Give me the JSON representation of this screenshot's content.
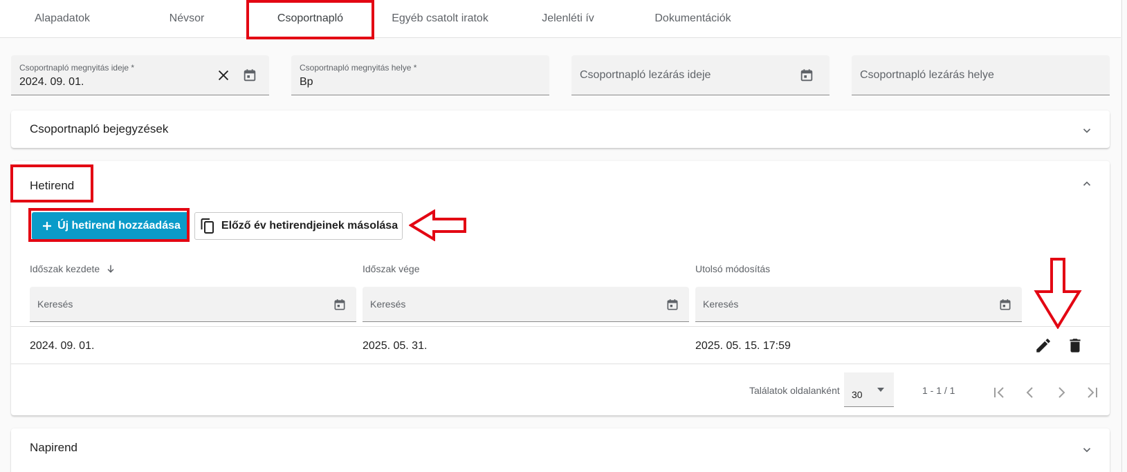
{
  "tabs": [
    {
      "label": "Alapadatok"
    },
    {
      "label": "Névsor"
    },
    {
      "label": "Csoportnapló"
    },
    {
      "label": "Egyéb csatolt iratok"
    },
    {
      "label": "Jelenléti ív"
    },
    {
      "label": "Dokumentációk"
    }
  ],
  "active_tab": "Csoportnapló",
  "form": {
    "open_date_label": "Csoportnapló megnyitás ideje *",
    "open_date_value": "2024. 09. 01.",
    "open_place_label": "Csoportnapló megnyitás helye *",
    "open_place_value": "Bp",
    "close_date_placeholder": "Csoportnapló lezárás ideje",
    "close_place_placeholder": "Csoportnapló lezárás helye"
  },
  "panels": {
    "entries_title": "Csoportnapló bejegyzések",
    "weekly_title": "Hetirend",
    "daily_title": "Napirend"
  },
  "weekly": {
    "add_button": "Új hetirend hozzáadása",
    "copy_button": "Előző év hetirendjeinek másolása",
    "columns": [
      "Időszak kezdete",
      "Időszak vége",
      "Utolsó módosítás"
    ],
    "search_placeholder": "Keresés",
    "rows": [
      {
        "start": "2024. 09. 01.",
        "end": "2025. 05. 31.",
        "modified": "2025. 05. 15. 17:59"
      }
    ],
    "pagination": {
      "per_page_label": "Találatok oldalanként",
      "per_page_value": "30",
      "range": "1 - 1 / 1"
    }
  },
  "colors": {
    "primary": "#0a9bc9",
    "annotation": "#e30613"
  },
  "icons": [
    "close-icon",
    "calendar-icon",
    "chevron-down-icon",
    "chevron-up-icon",
    "plus-icon",
    "copy-icon",
    "arrow-down-icon",
    "edit-icon",
    "delete-icon",
    "first-page-icon",
    "prev-page-icon",
    "next-page-icon",
    "last-page-icon"
  ]
}
